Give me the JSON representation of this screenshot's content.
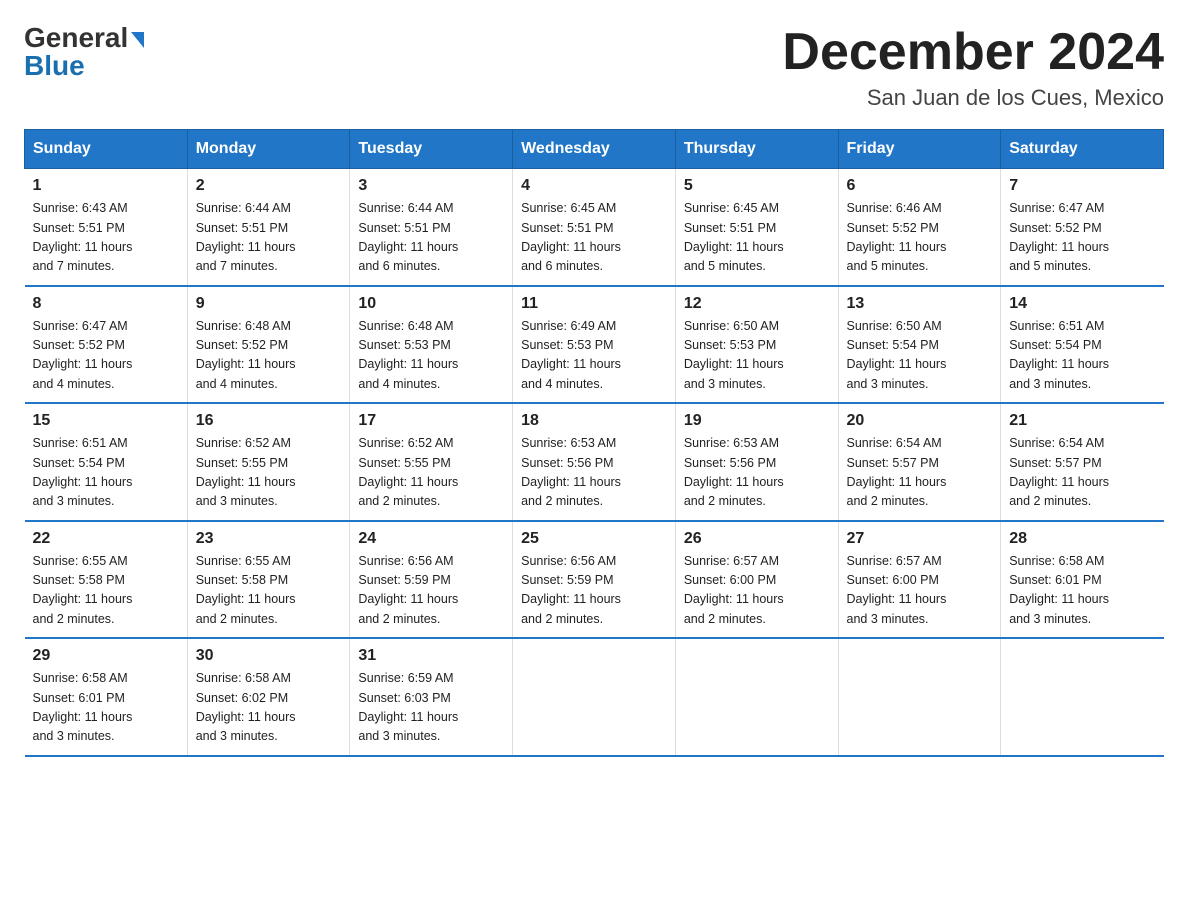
{
  "logo": {
    "general": "General",
    "blue": "Blue",
    "arrow": "▶"
  },
  "title": "December 2024",
  "subtitle": "San Juan de los Cues, Mexico",
  "days_of_week": [
    "Sunday",
    "Monday",
    "Tuesday",
    "Wednesday",
    "Thursday",
    "Friday",
    "Saturday"
  ],
  "weeks": [
    [
      {
        "day": "1",
        "sunrise": "6:43 AM",
        "sunset": "5:51 PM",
        "daylight": "11 hours and 7 minutes."
      },
      {
        "day": "2",
        "sunrise": "6:44 AM",
        "sunset": "5:51 PM",
        "daylight": "11 hours and 7 minutes."
      },
      {
        "day": "3",
        "sunrise": "6:44 AM",
        "sunset": "5:51 PM",
        "daylight": "11 hours and 6 minutes."
      },
      {
        "day": "4",
        "sunrise": "6:45 AM",
        "sunset": "5:51 PM",
        "daylight": "11 hours and 6 minutes."
      },
      {
        "day": "5",
        "sunrise": "6:45 AM",
        "sunset": "5:51 PM",
        "daylight": "11 hours and 5 minutes."
      },
      {
        "day": "6",
        "sunrise": "6:46 AM",
        "sunset": "5:52 PM",
        "daylight": "11 hours and 5 minutes."
      },
      {
        "day": "7",
        "sunrise": "6:47 AM",
        "sunset": "5:52 PM",
        "daylight": "11 hours and 5 minutes."
      }
    ],
    [
      {
        "day": "8",
        "sunrise": "6:47 AM",
        "sunset": "5:52 PM",
        "daylight": "11 hours and 4 minutes."
      },
      {
        "day": "9",
        "sunrise": "6:48 AM",
        "sunset": "5:52 PM",
        "daylight": "11 hours and 4 minutes."
      },
      {
        "day": "10",
        "sunrise": "6:48 AM",
        "sunset": "5:53 PM",
        "daylight": "11 hours and 4 minutes."
      },
      {
        "day": "11",
        "sunrise": "6:49 AM",
        "sunset": "5:53 PM",
        "daylight": "11 hours and 4 minutes."
      },
      {
        "day": "12",
        "sunrise": "6:50 AM",
        "sunset": "5:53 PM",
        "daylight": "11 hours and 3 minutes."
      },
      {
        "day": "13",
        "sunrise": "6:50 AM",
        "sunset": "5:54 PM",
        "daylight": "11 hours and 3 minutes."
      },
      {
        "day": "14",
        "sunrise": "6:51 AM",
        "sunset": "5:54 PM",
        "daylight": "11 hours and 3 minutes."
      }
    ],
    [
      {
        "day": "15",
        "sunrise": "6:51 AM",
        "sunset": "5:54 PM",
        "daylight": "11 hours and 3 minutes."
      },
      {
        "day": "16",
        "sunrise": "6:52 AM",
        "sunset": "5:55 PM",
        "daylight": "11 hours and 3 minutes."
      },
      {
        "day": "17",
        "sunrise": "6:52 AM",
        "sunset": "5:55 PM",
        "daylight": "11 hours and 2 minutes."
      },
      {
        "day": "18",
        "sunrise": "6:53 AM",
        "sunset": "5:56 PM",
        "daylight": "11 hours and 2 minutes."
      },
      {
        "day": "19",
        "sunrise": "6:53 AM",
        "sunset": "5:56 PM",
        "daylight": "11 hours and 2 minutes."
      },
      {
        "day": "20",
        "sunrise": "6:54 AM",
        "sunset": "5:57 PM",
        "daylight": "11 hours and 2 minutes."
      },
      {
        "day": "21",
        "sunrise": "6:54 AM",
        "sunset": "5:57 PM",
        "daylight": "11 hours and 2 minutes."
      }
    ],
    [
      {
        "day": "22",
        "sunrise": "6:55 AM",
        "sunset": "5:58 PM",
        "daylight": "11 hours and 2 minutes."
      },
      {
        "day": "23",
        "sunrise": "6:55 AM",
        "sunset": "5:58 PM",
        "daylight": "11 hours and 2 minutes."
      },
      {
        "day": "24",
        "sunrise": "6:56 AM",
        "sunset": "5:59 PM",
        "daylight": "11 hours and 2 minutes."
      },
      {
        "day": "25",
        "sunrise": "6:56 AM",
        "sunset": "5:59 PM",
        "daylight": "11 hours and 2 minutes."
      },
      {
        "day": "26",
        "sunrise": "6:57 AM",
        "sunset": "6:00 PM",
        "daylight": "11 hours and 2 minutes."
      },
      {
        "day": "27",
        "sunrise": "6:57 AM",
        "sunset": "6:00 PM",
        "daylight": "11 hours and 3 minutes."
      },
      {
        "day": "28",
        "sunrise": "6:58 AM",
        "sunset": "6:01 PM",
        "daylight": "11 hours and 3 minutes."
      }
    ],
    [
      {
        "day": "29",
        "sunrise": "6:58 AM",
        "sunset": "6:01 PM",
        "daylight": "11 hours and 3 minutes."
      },
      {
        "day": "30",
        "sunrise": "6:58 AM",
        "sunset": "6:02 PM",
        "daylight": "11 hours and 3 minutes."
      },
      {
        "day": "31",
        "sunrise": "6:59 AM",
        "sunset": "6:03 PM",
        "daylight": "11 hours and 3 minutes."
      },
      null,
      null,
      null,
      null
    ]
  ],
  "labels": {
    "sunrise": "Sunrise:",
    "sunset": "Sunset:",
    "daylight": "Daylight:"
  }
}
